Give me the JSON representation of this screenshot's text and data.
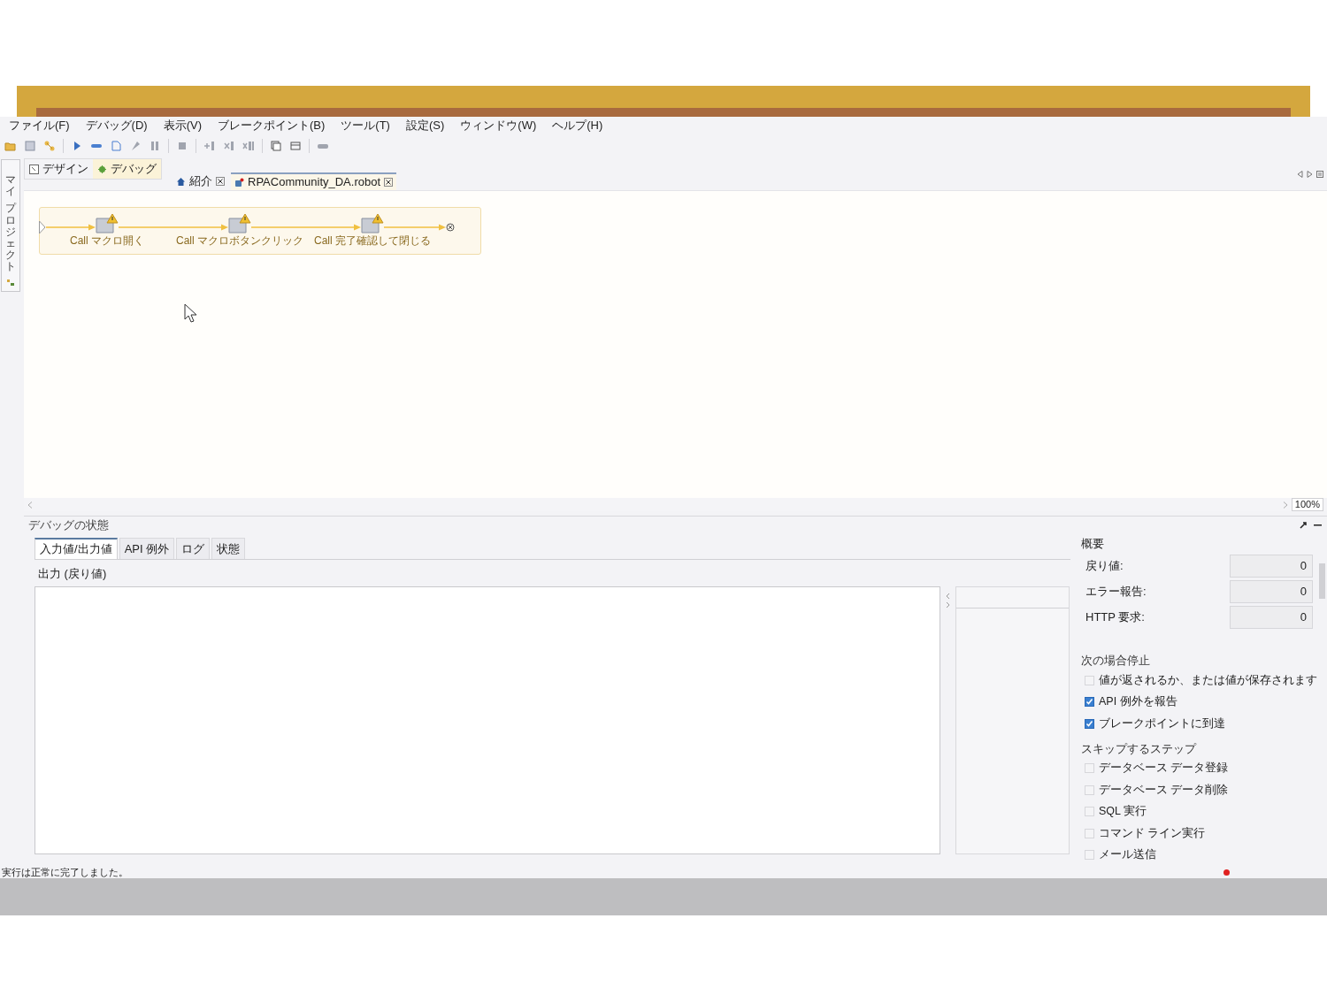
{
  "menu": [
    "ファイル(F)",
    "デバッグ(D)",
    "表示(V)",
    "ブレークポイント(B)",
    "ツール(T)",
    "設定(S)",
    "ウィンドウ(W)",
    "ヘルプ(H)"
  ],
  "side_tab": {
    "labels": [
      "マイ",
      "プロジェクト"
    ]
  },
  "perspectives": [
    {
      "label": "デザイン",
      "selected": false
    },
    {
      "label": "デバッグ",
      "selected": true
    }
  ],
  "editor_tabs": [
    {
      "label": "紹介",
      "kind": "home",
      "selected": false
    },
    {
      "label": "RPACommunity_DA.robot",
      "kind": "robot",
      "selected": true
    }
  ],
  "flow": {
    "steps": [
      "Call マクロ開く",
      "Call マクロボタンクリック",
      "Call 完了確認して閉じる"
    ]
  },
  "zoom": "100%",
  "debug_panel": {
    "title": "デバッグの状態",
    "tabs": [
      {
        "label": "入力値/出力値",
        "selected": true
      },
      {
        "label": "API 例外",
        "selected": false
      },
      {
        "label": "ログ",
        "selected": false
      },
      {
        "label": "状態",
        "selected": false
      }
    ],
    "output_label": "出力 (戻り値)"
  },
  "summary": {
    "title": "概要",
    "fields": [
      {
        "label": "戻り値:",
        "value": "0"
      },
      {
        "label": "エラー報告:",
        "value": "0"
      },
      {
        "label": "HTTP 要求:",
        "value": "0"
      }
    ]
  },
  "stop_when": {
    "title": "次の場合停止",
    "options": [
      {
        "label": "値が返されるか、または値が保存されます",
        "checked": false
      },
      {
        "label": "API 例外を報告",
        "checked": true
      },
      {
        "label": "ブレークポイントに到達",
        "checked": true
      }
    ]
  },
  "skip_steps": {
    "title": "スキップするステップ",
    "options": [
      {
        "label": "データベース データ登録",
        "checked": false
      },
      {
        "label": "データベース データ削除",
        "checked": false
      },
      {
        "label": "SQL 実行",
        "checked": false
      },
      {
        "label": "コマンド ライン実行",
        "checked": false
      },
      {
        "label": "メール送信",
        "checked": false
      }
    ]
  },
  "status_bar": {
    "text": "実行は正常に完了しました。"
  }
}
